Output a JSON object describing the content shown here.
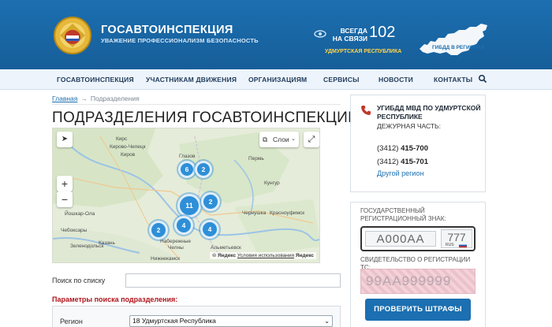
{
  "header": {
    "title": "ГОСАВТОИНСПЕКЦИЯ",
    "subtitle": "УВАЖЕНИЕ ПРОФЕССИОНАЛИЗМ БЕЗОПАСНОСТЬ",
    "always_line1": "ВСЕГДА",
    "always_line2": "НА СВЯЗИ",
    "phone": "102",
    "region": "УДМУРТСКАЯ РЕСПУБЛИКА",
    "regions_map_label": "ГИБДД В РЕГИОНАХ"
  },
  "nav": {
    "items": [
      {
        "label": "ГОСАВТОИНСПЕКЦИЯ"
      },
      {
        "label": "УЧАСТНИКАМ ДВИЖЕНИЯ"
      },
      {
        "label": "ОРГАНИЗАЦИЯМ"
      },
      {
        "label": "СЕРВИСЫ"
      },
      {
        "label": "НОВОСТИ"
      },
      {
        "label": "КОНТАКТЫ"
      }
    ]
  },
  "breadcrumb": {
    "home": "Главная",
    "separator": "→",
    "current": "Подразделения"
  },
  "page_title": "ПОДРАЗДЕЛЕНИЯ ГОСАВТОИНСПЕКЦИИ",
  "map": {
    "layers_label": "Слои",
    "zoom_in": "+",
    "zoom_out": "−",
    "cities": [
      "Кирс",
      "Кирово-Чепецк",
      "Киров",
      "Глазов",
      "Пермь",
      "Кунгур",
      "Чернушка",
      "Красноуфимск",
      "Йошкар-Ола",
      "Чебоксары",
      "Зеленодольск",
      "Казань",
      "Набережные",
      "Челны",
      "Нижнекамск",
      "Альметьевск"
    ],
    "clusters": [
      {
        "count": "6"
      },
      {
        "count": "2"
      },
      {
        "count": "11"
      },
      {
        "count": "2"
      },
      {
        "count": "4"
      },
      {
        "count": "4"
      },
      {
        "count": "2"
      }
    ],
    "copyright": "© Яндекс",
    "terms": "Условия использования",
    "brand": "Яндекс"
  },
  "form": {
    "search_label": "Поиск по списку",
    "search_value": "",
    "params_title": "Параметры поиска подразделения:",
    "region_label": "Регион",
    "region_value": "18 Удмуртская Республика"
  },
  "contact_card": {
    "dept_name": "УГИБДД МВД ПО УДМУРТСКОЙ РЕСПУБЛИКЕ",
    "duty_label": "ДЕЖУРНАЯ ЧАСТЬ:",
    "phone1_code": "(3412)",
    "phone1_num": "415-700",
    "phone2_code": "(3412)",
    "phone2_num": "415-701",
    "other_region": "Другой регион"
  },
  "fines_card": {
    "plate_label": "ГОСУДАРСТВЕННЫЙ РЕГИСТРАЦИОННЫЙ ЗНАК:",
    "plate_placeholder": "А000АА",
    "region_placeholder": "777",
    "plate_country": "RUS",
    "cert_label": "СВИДЕТЕЛЬСТВО О РЕГИСТРАЦИИ ТС:",
    "cert_placeholder": "99АА999999",
    "button": "ПРОВЕРИТЬ ШТРАФЫ"
  },
  "colors": {
    "brand_blue": "#1c6fb0",
    "accent_yellow": "#ffd54a",
    "params_red": "#b0131a",
    "cluster_blue": "#2e8fd8"
  }
}
